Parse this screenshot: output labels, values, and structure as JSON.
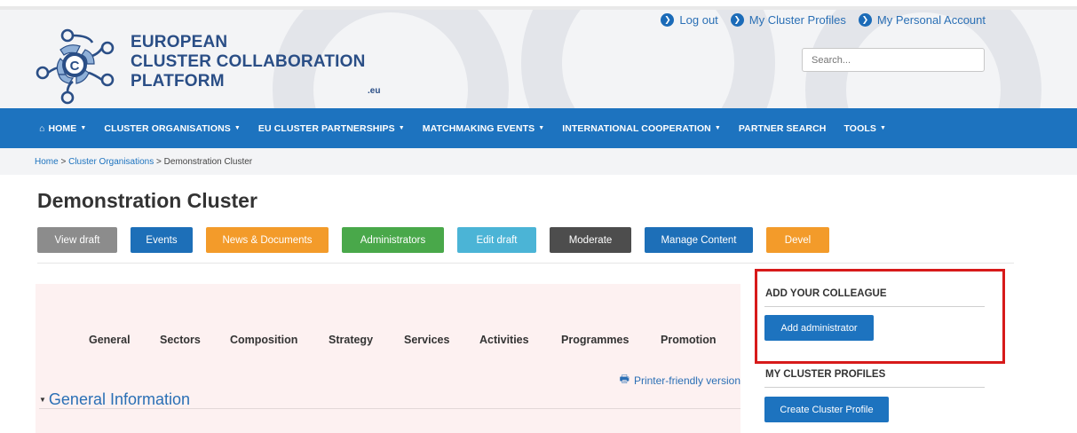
{
  "header": {
    "logo": {
      "line1": "EUROPEAN",
      "line2": "CLUSTER COLLABORATION",
      "line3": "PLATFORM",
      "suffix": ".eu"
    },
    "utility_links": [
      {
        "label": "Log out",
        "icon": "chevron-right-icon"
      },
      {
        "label": "My Cluster Profiles",
        "icon": "chevron-right-icon"
      },
      {
        "label": "My Personal Account",
        "icon": "chevron-right-icon"
      }
    ],
    "search": {
      "placeholder": "Search...",
      "value": ""
    }
  },
  "nav": {
    "items": [
      {
        "label": "HOME",
        "icon": "home-icon",
        "dropdown": true
      },
      {
        "label": "CLUSTER ORGANISATIONS",
        "dropdown": true
      },
      {
        "label": "EU CLUSTER PARTNERSHIPS",
        "dropdown": true
      },
      {
        "label": "MATCHMAKING EVENTS",
        "dropdown": true
      },
      {
        "label": "INTERNATIONAL COOPERATION",
        "dropdown": true
      },
      {
        "label": "PARTNER SEARCH",
        "dropdown": false
      },
      {
        "label": "TOOLS",
        "dropdown": true
      }
    ]
  },
  "breadcrumb": {
    "items": [
      "Home",
      "Cluster Organisations",
      "Demonstration Cluster"
    ],
    "separator": ">"
  },
  "page": {
    "title": "Demonstration Cluster"
  },
  "actions": [
    {
      "label": "View draft",
      "color": "#8c8c8c"
    },
    {
      "label": "Events",
      "color": "#1d6fb8"
    },
    {
      "label": "News & Documents",
      "color": "#f39b2a"
    },
    {
      "label": "Administrators",
      "color": "#49a84a"
    },
    {
      "label": "Edit draft",
      "color": "#4bb4d6"
    },
    {
      "label": "Moderate",
      "color": "#4d4d4d"
    },
    {
      "label": "Manage Content",
      "color": "#1d6fb8"
    },
    {
      "label": "Devel",
      "color": "#f39b2a"
    }
  ],
  "tabs": [
    "General",
    "Sectors",
    "Composition",
    "Strategy",
    "Services",
    "Activities",
    "Programmes",
    "Promotion"
  ],
  "printer_link": {
    "label": "Printer-friendly version",
    "icon": "printer-icon"
  },
  "section": {
    "title": "General Information",
    "icon": "caret-down-icon"
  },
  "sidebar": {
    "add_colleague": {
      "title": "ADD YOUR COLLEAGUE",
      "button": "Add administrator"
    },
    "cluster_profiles": {
      "title": "MY CLUSTER PROFILES",
      "button": "Create Cluster Profile"
    }
  },
  "colors": {
    "brand": "#1d73bf",
    "logo_text": "#2a4e86",
    "highlight": "#d71a1a",
    "panel_bg": "#fdf1f1"
  }
}
